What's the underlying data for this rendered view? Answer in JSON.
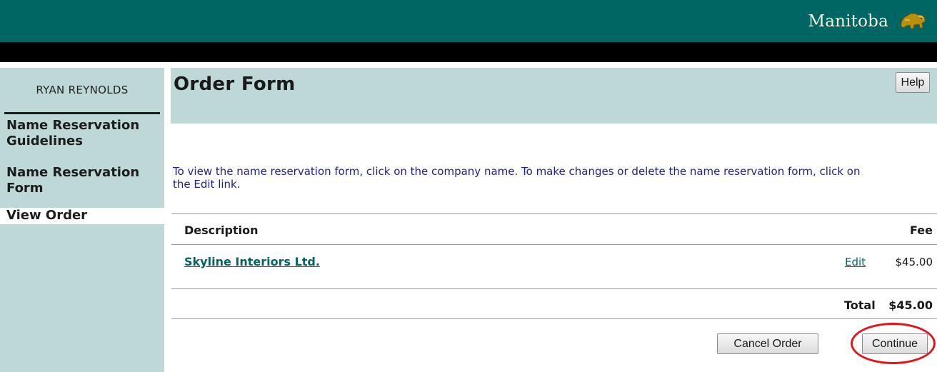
{
  "header": {
    "brand_text": "Manitoba",
    "logo_icon": "manitoba-bison-icon",
    "colors": {
      "band": "#006664",
      "stripe": "#000000",
      "panel": "#bdd8d6"
    }
  },
  "sidebar": {
    "user_name": "RYAN REYNOLDS",
    "items": [
      {
        "label": "Name Reservation Guidelines",
        "active": false
      },
      {
        "label": "Name Reservation Form",
        "active": false
      },
      {
        "label": "View Order",
        "active": true
      }
    ]
  },
  "main": {
    "title": "Order Form",
    "help_label": "Help",
    "instructions": "To view the name reservation form, click on the company name. To make changes or delete the name reservation form, click on the Edit link.",
    "table": {
      "columns": [
        "Description",
        "Fee"
      ],
      "rows": [
        {
          "description": "Skyline Interiors Ltd.",
          "edit_label": "Edit",
          "fee": "$45.00"
        }
      ],
      "total_label": "Total",
      "total_value": "$45.00"
    },
    "buttons": {
      "cancel_label": "Cancel Order",
      "continue_label": "Continue"
    },
    "annotation_color": "#e5131b"
  }
}
